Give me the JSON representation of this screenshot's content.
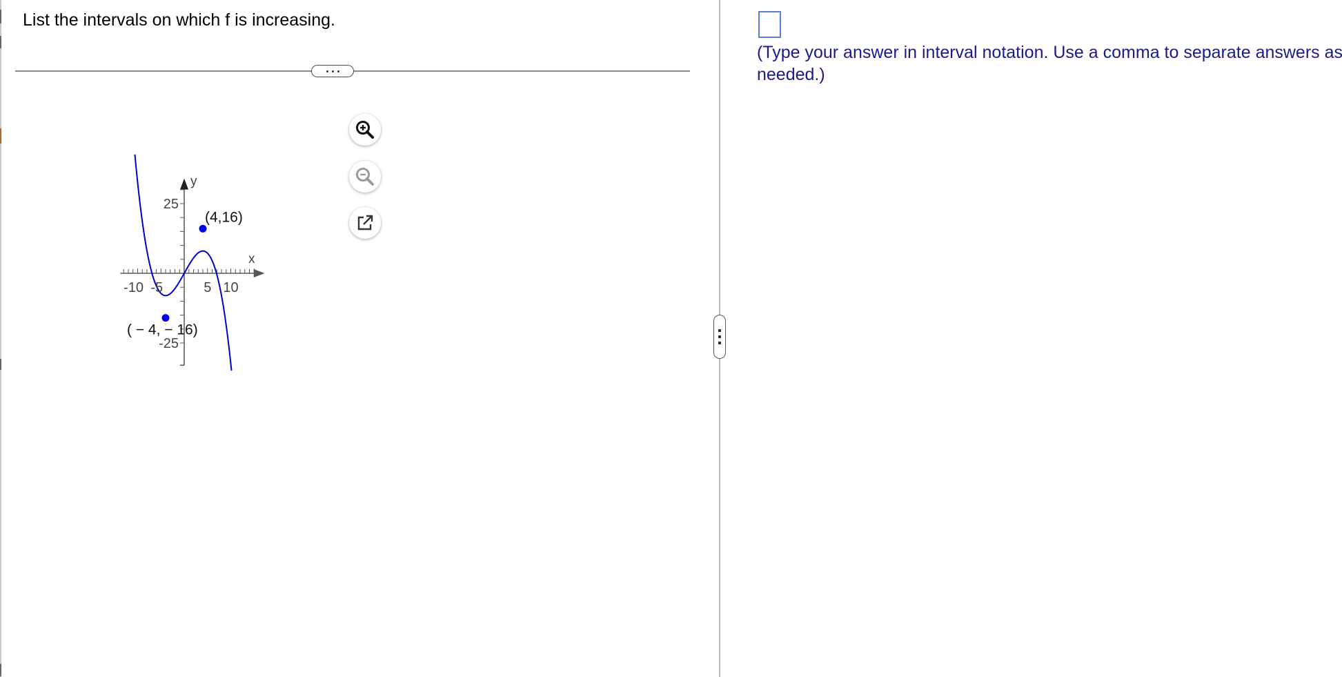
{
  "question": {
    "text": "List the intervals on which f is increasing."
  },
  "answer": {
    "value": "",
    "instructions": "(Type your answer in interval notation. Use a comma to separate answers as needed.)"
  },
  "icons": {
    "zoom_in": "zoom-in-icon",
    "zoom_out": "zoom-out-icon",
    "popout": "popout-icon",
    "more": "more-options-icon",
    "split": "split-handle-icon"
  },
  "colors": {
    "curve": "#0000cc",
    "point": "#0000ee",
    "axis": "#555555",
    "instructions_text": "#1a1a8c",
    "answer_box_border": "#5b7fd6"
  },
  "chart_data": {
    "type": "line",
    "xlabel": "x",
    "ylabel": "y",
    "xlim": [
      -14,
      17
    ],
    "ylim": [
      -30,
      33
    ],
    "x_ticks": {
      "step": 1,
      "labels": [
        "-10",
        "-5",
        "5",
        "10"
      ],
      "label_values": [
        -10,
        -5,
        5,
        10
      ]
    },
    "y_ticks": {
      "step": 5,
      "labels": [
        "25",
        "-25"
      ],
      "label_values": [
        25,
        -25
      ]
    },
    "series": [
      {
        "function": "-x^3/16 + 3x",
        "x_range": [
          -11.2,
          11.2
        ],
        "x": [
          -11,
          -10,
          -8,
          -6,
          -4,
          -2,
          0,
          2,
          4,
          6,
          8,
          10,
          11
        ],
        "y": [
          50.2,
          32.5,
          8,
          -4.5,
          -16,
          -5.5,
          0,
          5.5,
          16,
          4.5,
          -8,
          -32.5,
          -50.2
        ]
      }
    ],
    "points": [
      {
        "x": 4,
        "y": 16,
        "label": "(4,16)"
      },
      {
        "x": -4,
        "y": -16,
        "label": "( − 4, − 16)"
      }
    ],
    "grid": false,
    "legend": "none"
  }
}
